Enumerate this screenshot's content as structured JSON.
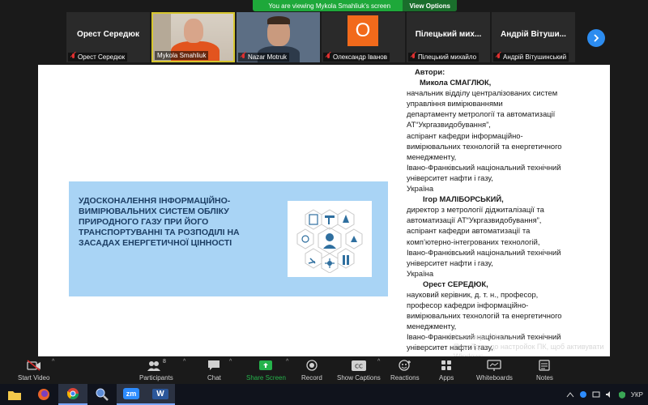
{
  "banner": {
    "text": "You are viewing Mykola Smahliuk's screen",
    "view_options": "View Options"
  },
  "participants": [
    {
      "center_name": "Орест Середюк",
      "label": "Орест Середюк",
      "muted": true
    },
    {
      "center_name": "",
      "label": "Mykola Smahliuk",
      "muted": false
    },
    {
      "center_name": "",
      "label": "Nazar Motruk",
      "muted": true
    },
    {
      "avatar": "О",
      "label": "Олександр Іванов",
      "muted": true
    },
    {
      "center_name": "Пілецький мих...",
      "label": "Пілецький михайло",
      "muted": true
    },
    {
      "center_name": "Андрій Вітуши...",
      "label": "Андрій Вітушинський",
      "muted": true
    }
  ],
  "slide": {
    "title": "Удосконалення інформаційно-вимірювальних систем обліку природного газу при його транспортуванні та розподілі на засадах енергетичної цінності",
    "authors_header": "Автори:",
    "author1_name": "Микола СМАГЛЮК,",
    "author1_lines": [
      "начальник відділу централізованих систем",
      "управління вимірюваннями",
      "департаменту метрології та автоматизації",
      "АТ“Укргазвидобування”,",
      "аспірант кафедри інформаційно-",
      "вимірювальних технологій та енергетичного",
      "менеджменту,",
      "Івано-Франківський національний технічний",
      "університет нафти і газу,",
      "Україна"
    ],
    "author2_name": "Ігор МАЛІБОРСЬКИЙ,",
    "author2_lines": [
      "директор з метрології діджиталізації та",
      "автоматизації АТ“Укргазвидобування”,",
      "аспірант кафедри автоматизації та",
      "комп’ютерно-інтегрованих технологій,",
      "Івано-Франківський національний технічний",
      "університет нафти і газу,",
      "Україна"
    ],
    "author3_name": "Орест СЕРЕДЮК,",
    "author3_lines": [
      "науковий керівник, д. т. н., професор,",
      "професор кафедри інформаційно-",
      "вимірювальних технологій та енергетичного",
      "менеджменту,",
      "Івано-Франківський національний технічний",
      "університет нафти і газу,"
    ]
  },
  "watermark": {
    "line1": "Активація Windows",
    "line2": "Перейдіть до настройок ПК, щоб активувати",
    "line3": "Windows."
  },
  "toolbar": {
    "start_video": "Start Video",
    "participants": "Participants",
    "participants_count": "8",
    "chat": "Chat",
    "share_screen": "Share Screen",
    "record": "Record",
    "show_captions": "Show Captions",
    "reactions": "Reactions",
    "apps": "Apps",
    "whiteboards": "Whiteboards",
    "notes": "Notes"
  },
  "taskbar": {
    "zoom_label": "zm",
    "word_label": "W",
    "lang": "УКР"
  },
  "colors": {
    "share_green": "#25b34b",
    "banner_green": "#1ea83a",
    "title_box": "#a9d4f5",
    "accent_blue": "#2c8cf0",
    "muted_red": "#e03030"
  }
}
